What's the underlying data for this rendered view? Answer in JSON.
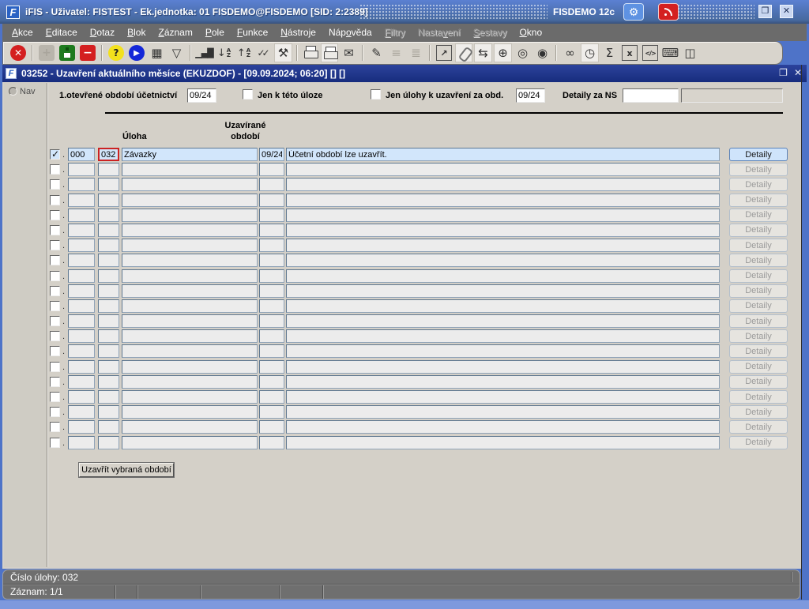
{
  "titlebar": {
    "title": "iFIS - Uživatel: FISTEST - Ek.jednotka: 01 FISDEMO@FISDEMO   [SID: 2:2389]",
    "environment": "FISDEMO 12c",
    "logo_text": "F"
  },
  "menubar": {
    "items": [
      {
        "label": "Akce",
        "mnemonic": 0,
        "enabled": true
      },
      {
        "label": "Editace",
        "mnemonic": 0,
        "enabled": true
      },
      {
        "label": "Dotaz",
        "mnemonic": 0,
        "enabled": true
      },
      {
        "label": "Blok",
        "mnemonic": 0,
        "enabled": true
      },
      {
        "label": "Záznam",
        "mnemonic": 0,
        "enabled": true
      },
      {
        "label": "Pole",
        "mnemonic": 0,
        "enabled": true
      },
      {
        "label": "Funkce",
        "mnemonic": 0,
        "enabled": true
      },
      {
        "label": "Nástroje",
        "mnemonic": 0,
        "enabled": true
      },
      {
        "label": "Nápověda",
        "mnemonic": 3,
        "enabled": true
      },
      {
        "label": "Filtry",
        "mnemonic": 0,
        "enabled": false
      },
      {
        "label": "Nastavení",
        "mnemonic": 5,
        "enabled": false
      },
      {
        "label": "Sestavy",
        "mnemonic": 0,
        "enabled": false
      },
      {
        "label": "Okno",
        "mnemonic": 0,
        "enabled": true
      }
    ]
  },
  "toolbar": {
    "items": [
      {
        "name": "exit-icon",
        "glyph": "✕",
        "style": "c-red"
      },
      {
        "type": "sep"
      },
      {
        "name": "insert-record-icon",
        "glyph": "+",
        "style": "s-gray",
        "enabled": false
      },
      {
        "name": "save-icon",
        "glyph": "",
        "style": "s-green floppy"
      },
      {
        "name": "delete-record-icon",
        "glyph": "−",
        "style": "s-red"
      },
      {
        "type": "sep"
      },
      {
        "name": "help-icon",
        "glyph": "?",
        "style": "c-yellow"
      },
      {
        "name": "execute-query-icon",
        "glyph": "▶",
        "style": "c-blue"
      },
      {
        "name": "calendar-icon",
        "glyph": "▦",
        "style": "plain"
      },
      {
        "name": "filter-icon",
        "glyph": "▽",
        "style": "plain"
      },
      {
        "type": "sep"
      },
      {
        "name": "chart-icon",
        "glyph": "▁▄█",
        "style": "plain bars"
      },
      {
        "name": "sort-desc-icon",
        "glyph": "↓",
        "style": "plain sort"
      },
      {
        "name": "sort-asc-icon",
        "glyph": "↑",
        "style": "plain sort"
      },
      {
        "name": "validate-icon",
        "glyph": "✓✓",
        "style": "plain tight"
      },
      {
        "name": "tools-icon",
        "glyph": "⚒",
        "style": "plain light"
      },
      {
        "type": "sep"
      },
      {
        "name": "print-icon",
        "glyph": "",
        "style": "printer"
      },
      {
        "name": "print-preview-icon",
        "glyph": "",
        "style": "printer light"
      },
      {
        "name": "mail-icon",
        "glyph": "✉",
        "style": "plain"
      },
      {
        "type": "sep"
      },
      {
        "name": "edit-icon",
        "glyph": "✎",
        "style": "plain"
      },
      {
        "name": "list-values-icon",
        "glyph": "≡",
        "style": "plain",
        "enabled": false
      },
      {
        "name": "checklist-icon",
        "glyph": "≣",
        "style": "plain",
        "enabled": false
      },
      {
        "type": "sep"
      },
      {
        "name": "external-window-icon",
        "glyph": "↗",
        "style": "boxed"
      },
      {
        "name": "attachment-icon",
        "glyph": "",
        "style": "clip light"
      },
      {
        "name": "routing-icon",
        "glyph": "⇆",
        "style": "plain light"
      },
      {
        "name": "web-icon",
        "glyph": "⊕",
        "style": "plain light"
      },
      {
        "name": "compass-icon",
        "glyph": "◎",
        "style": "plain"
      },
      {
        "name": "preview-icon",
        "glyph": "◉",
        "style": "plain"
      },
      {
        "type": "sep"
      },
      {
        "name": "glasses-icon",
        "glyph": "∞",
        "style": "plain"
      },
      {
        "name": "history-icon",
        "glyph": "◷",
        "style": "plain light"
      },
      {
        "name": "sum-icon",
        "glyph": "Σ",
        "style": "plain"
      },
      {
        "name": "excel-icon",
        "glyph": "x",
        "style": "boxed"
      },
      {
        "name": "script-icon",
        "glyph": "</>",
        "style": "boxed small"
      },
      {
        "name": "keyboard-icon",
        "glyph": "⌨",
        "style": "plain"
      },
      {
        "name": "reader-icon",
        "glyph": "◫",
        "style": "plain"
      }
    ]
  },
  "window": {
    "title": "03252 - Uzavření aktuálního měsíce (EKUZDOF) - [09.09.2024; 06:20]  [] []",
    "logo_text": "F"
  },
  "sidebar": {
    "nav_label": "Nav"
  },
  "filters": {
    "open_period_label": "1.otevřené období účetnictví",
    "open_period_value": "09/24",
    "only_this_task_label": "Jen k této úloze",
    "only_this_task_checked": false,
    "tasks_to_close_label": "Jen úlohy k uzavření za obd.",
    "tasks_to_close_checked": false,
    "tasks_to_close_value": "09/24",
    "ns_details_label": "Detaily za NS",
    "ns_code_value": "",
    "ns_name_value": ""
  },
  "table": {
    "task_header": "Úloha",
    "period_header_line1": "Uzavírané",
    "period_header_line2": "období",
    "detail_label": "Detaily",
    "rows": [
      {
        "selected": true,
        "code1": "000",
        "code2": "032",
        "name": "Závazky",
        "period": "09/24",
        "status": "Účetní období lze uzavřít.",
        "active": true
      },
      {
        "selected": false,
        "code1": "",
        "code2": "",
        "name": "",
        "period": "",
        "status": "",
        "active": false
      },
      {
        "selected": false,
        "code1": "",
        "code2": "",
        "name": "",
        "period": "",
        "status": "",
        "active": false
      },
      {
        "selected": false,
        "code1": "",
        "code2": "",
        "name": "",
        "period": "",
        "status": "",
        "active": false
      },
      {
        "selected": false,
        "code1": "",
        "code2": "",
        "name": "",
        "period": "",
        "status": "",
        "active": false
      },
      {
        "selected": false,
        "code1": "",
        "code2": "",
        "name": "",
        "period": "",
        "status": "",
        "active": false
      },
      {
        "selected": false,
        "code1": "",
        "code2": "",
        "name": "",
        "period": "",
        "status": "",
        "active": false
      },
      {
        "selected": false,
        "code1": "",
        "code2": "",
        "name": "",
        "period": "",
        "status": "",
        "active": false
      },
      {
        "selected": false,
        "code1": "",
        "code2": "",
        "name": "",
        "period": "",
        "status": "",
        "active": false
      },
      {
        "selected": false,
        "code1": "",
        "code2": "",
        "name": "",
        "period": "",
        "status": "",
        "active": false
      },
      {
        "selected": false,
        "code1": "",
        "code2": "",
        "name": "",
        "period": "",
        "status": "",
        "active": false
      },
      {
        "selected": false,
        "code1": "",
        "code2": "",
        "name": "",
        "period": "",
        "status": "",
        "active": false
      },
      {
        "selected": false,
        "code1": "",
        "code2": "",
        "name": "",
        "period": "",
        "status": "",
        "active": false
      },
      {
        "selected": false,
        "code1": "",
        "code2": "",
        "name": "",
        "period": "",
        "status": "",
        "active": false
      },
      {
        "selected": false,
        "code1": "",
        "code2": "",
        "name": "",
        "period": "",
        "status": "",
        "active": false
      },
      {
        "selected": false,
        "code1": "",
        "code2": "",
        "name": "",
        "period": "",
        "status": "",
        "active": false
      },
      {
        "selected": false,
        "code1": "",
        "code2": "",
        "name": "",
        "period": "",
        "status": "",
        "active": false
      },
      {
        "selected": false,
        "code1": "",
        "code2": "",
        "name": "",
        "period": "",
        "status": "",
        "active": false
      },
      {
        "selected": false,
        "code1": "",
        "code2": "",
        "name": "",
        "period": "",
        "status": "",
        "active": false
      },
      {
        "selected": false,
        "code1": "",
        "code2": "",
        "name": "",
        "period": "",
        "status": "",
        "active": false
      }
    ]
  },
  "footer": {
    "close_button": "Uzavřít vybraná období"
  },
  "statusbar": {
    "message": "Číslo úlohy: 032",
    "cells": [
      {
        "text": "Záznam: 1/1",
        "width": 142
      },
      {
        "text": "",
        "width": 28
      },
      {
        "text": "",
        "width": 80
      },
      {
        "text": "",
        "width": 100
      },
      {
        "text": "",
        "width": 55
      },
      {
        "text": "",
        "width": 0
      }
    ]
  }
}
